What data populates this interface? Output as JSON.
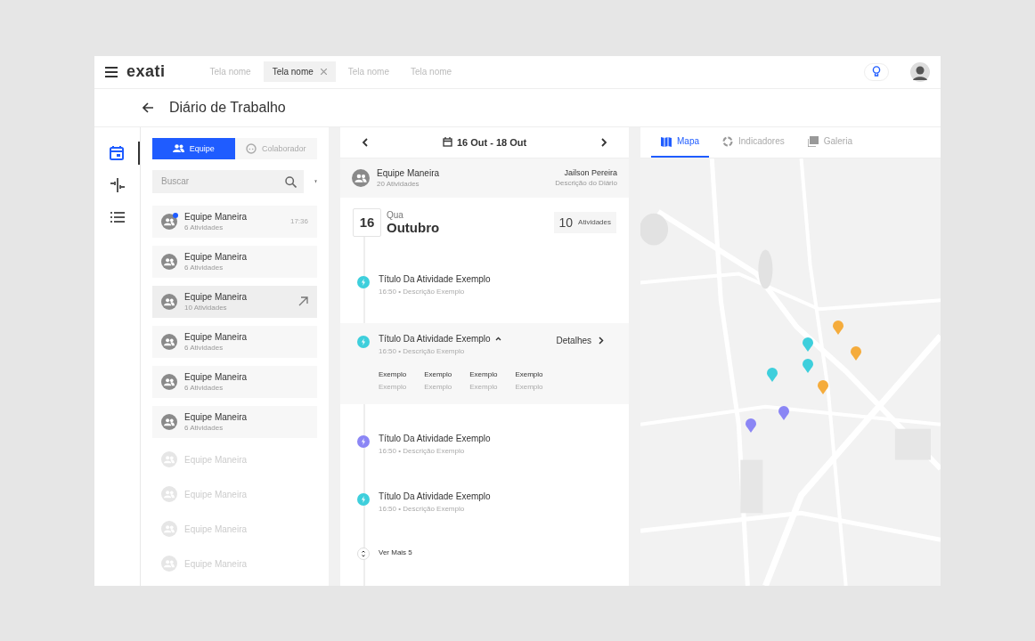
{
  "top_bar": {
    "logo": "exati",
    "tabs": [
      {
        "label": "Tela nome",
        "selected": false
      },
      {
        "label": "Tela nome",
        "selected": true
      },
      {
        "label": "Tela nome",
        "selected": false
      },
      {
        "label": "Tela nome",
        "selected": false
      }
    ]
  },
  "page": {
    "title": "Diário de Trabalho"
  },
  "rail": [
    {
      "kind": "calendar",
      "selected": true
    },
    {
      "kind": "split",
      "selected": false
    },
    {
      "kind": "list",
      "selected": false
    }
  ],
  "list_panel": {
    "toggle": [
      {
        "label": "Equipe",
        "selected": true
      },
      {
        "label": "Colaborador",
        "selected": false
      }
    ],
    "search": {
      "placeholder": "Buscar"
    },
    "items": [
      {
        "name": "Equipe Maneira",
        "count": "6 Atividades",
        "time": "17:36",
        "unread": true,
        "selected": false,
        "disabled": false
      },
      {
        "name": "Equipe Maneira",
        "count": "6 Atividades",
        "unread": false,
        "selected": false,
        "disabled": false
      },
      {
        "name": "Equipe Maneira",
        "count": "10 Atividades",
        "unread": false,
        "selected": true,
        "disabled": false
      },
      {
        "name": "Equipe Maneira",
        "count": "6 Atividades",
        "unread": false,
        "selected": false,
        "disabled": false
      },
      {
        "name": "Equipe Maneira",
        "count": "6 Atividades",
        "unread": false,
        "selected": false,
        "disabled": false
      },
      {
        "name": "Equipe Maneira",
        "count": "6 Atividades",
        "unread": false,
        "selected": false,
        "disabled": false
      },
      {
        "name": "Equipe Maneira",
        "unread": false,
        "selected": false,
        "disabled": true
      },
      {
        "name": "Equipe Maneira",
        "unread": false,
        "selected": false,
        "disabled": true
      },
      {
        "name": "Equipe Maneira",
        "unread": false,
        "selected": false,
        "disabled": true
      },
      {
        "name": "Equipe Maneira",
        "unread": false,
        "selected": false,
        "disabled": true
      }
    ]
  },
  "timeline": {
    "date_range": "16 Out - 18 Out",
    "header": {
      "team": "Equipe Maneira",
      "count": "20 Atividades",
      "person": "Jailson Pereira",
      "description": "Descrição do Diário"
    },
    "day": {
      "number": "16",
      "weekday": "Qua",
      "month": "Outubro",
      "total": "10",
      "total_label": "Atividades"
    },
    "activities": [
      {
        "title": "Título Da Atividade Exemplo",
        "meta": "16:50 • Descrição Exemplo",
        "color": "#3ecfdc",
        "expanded": false
      },
      {
        "title": "Título Da Atividade Exemplo",
        "meta": "16:50 • Descrição Exemplo",
        "color": "#3ecfdc",
        "expanded": true,
        "details": "Detalhes",
        "fields": [
          {
            "label": "Exemplo",
            "value": "Exemplo"
          },
          {
            "label": "Exemplo",
            "value": "Exemplo"
          },
          {
            "label": "Exemplo",
            "value": "Exemplo"
          },
          {
            "label": "Exemplo",
            "value": "Exemplo"
          }
        ]
      },
      {
        "title": "Título Da Atividade Exemplo",
        "meta": "16:50 • Descrição Exemplo",
        "color": "#8b86f5",
        "expanded": false
      },
      {
        "title": "Título Da Atividade Exemplo",
        "meta": "16:50 • Descrição Exemplo",
        "color": "#3ecfdc",
        "expanded": false
      }
    ],
    "more": "Ver Mais 5"
  },
  "map_panel": {
    "tabs": [
      {
        "label": "Mapa",
        "selected": true
      },
      {
        "label": "Indicadores",
        "selected": false
      },
      {
        "label": "Galeria",
        "selected": false
      }
    ],
    "pins": [
      {
        "color": "#f5ac3c"
      },
      {
        "color": "#f5ac3c"
      },
      {
        "color": "#f5ac3c"
      },
      {
        "color": "#3ecfdc"
      },
      {
        "color": "#3ecfdc"
      },
      {
        "color": "#3ecfdc"
      },
      {
        "color": "#8b86f5"
      },
      {
        "color": "#8b86f5"
      }
    ]
  }
}
